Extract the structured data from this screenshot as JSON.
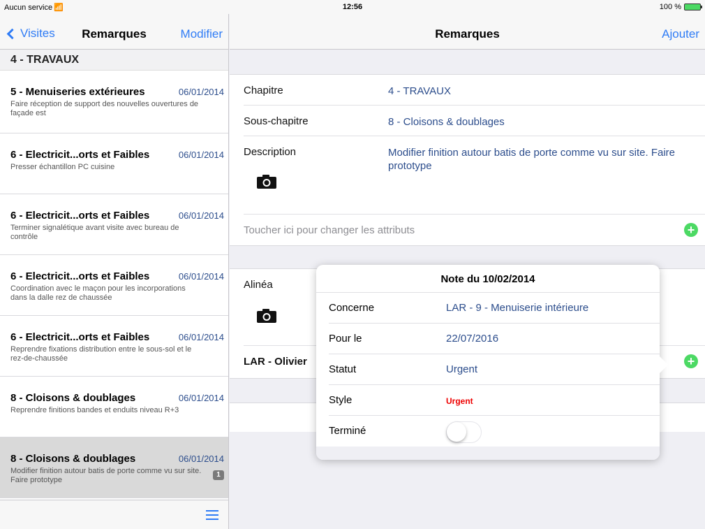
{
  "status_bar": {
    "carrier": "Aucun service",
    "time": "12:56",
    "battery": "100 %"
  },
  "left": {
    "back_label": "Visites",
    "title": "Remarques",
    "edit_label": "Modifier",
    "section": "4 - TRAVAUX",
    "items": [
      {
        "title": "5 - Menuiseries extérieures",
        "date": "06/01/2014",
        "desc": "Faire réception de support des nouvelles ouvertures de façade est"
      },
      {
        "title": "6 - Electricit...orts et Faibles",
        "date": "06/01/2014",
        "desc": "Presser échantillon PC cuisine"
      },
      {
        "title": "6 - Electricit...orts et Faibles",
        "date": "06/01/2014",
        "desc": "Terminer signalétique avant visite avec bureau de contrôle"
      },
      {
        "title": "6 - Electricit...orts et Faibles",
        "date": "06/01/2014",
        "desc": "Coordination avec le maçon pour les incorporations dans la dalle  rez de chaussée"
      },
      {
        "title": "6 - Electricit...orts et Faibles",
        "date": "06/01/2014",
        "desc": "Reprendre fixations  distribution entre le sous-sol et le rez-de-chaussée"
      },
      {
        "title": "8 - Cloisons & doublages",
        "date": "06/01/2014",
        "desc": "Reprendre finitions bandes et enduits niveau R+3"
      },
      {
        "title": "8 - Cloisons & doublages",
        "date": "06/01/2014",
        "desc": "Modifier finition autour batis de porte comme vu sur site. Faire prototype",
        "badge": "1"
      }
    ]
  },
  "right": {
    "title": "Remarques",
    "add_label": "Ajouter",
    "chapitre_label": "Chapitre",
    "chapitre_value": "4 - TRAVAUX",
    "souschapitre_label": "Sous-chapitre",
    "souschapitre_value": "8 - Cloisons & doublages",
    "description_label": "Description",
    "description_value": "Modifier finition autour batis de porte comme vu sur site. Faire prototype",
    "change_attrs": "Toucher ici pour changer les attributs",
    "alinea_label": "Alinéa",
    "lar_label": "LAR - Olivier"
  },
  "popover": {
    "title": "Note du 10/02/2014",
    "concerne_label": "Concerne",
    "concerne_value": "LAR - 9 - Menuiserie intérieure",
    "pourle_label": "Pour le",
    "pourle_value": "22/07/2016",
    "statut_label": "Statut",
    "statut_value": "Urgent",
    "style_label": "Style",
    "style_value": "Urgent",
    "termine_label": "Terminé",
    "termine_on": false
  },
  "colors": {
    "accent": "#2f7cf6",
    "value_text": "#2c4d8c",
    "urgent": "#e00000",
    "add_green": "#4cd964"
  }
}
